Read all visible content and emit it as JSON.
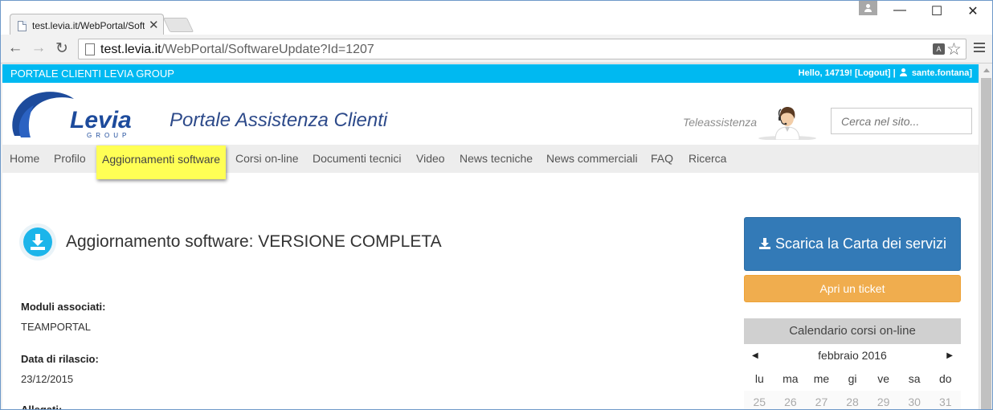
{
  "browser": {
    "tab_title": "test.levia.it/WebPortal/Soft",
    "tab_close": "✕",
    "url_host": "test.levia.it",
    "url_path": "/WebPortal/SoftwareUpdate?Id=1207",
    "translate_glyph": "A",
    "star_glyph": "☆",
    "window_minimize": "—",
    "window_maximize": "☐",
    "window_close": "✕",
    "back_glyph": "←",
    "forward_glyph": "→",
    "reload_glyph": "↻"
  },
  "topbar": {
    "title": "PORTALE CLIENTI LEVIA GROUP",
    "greeting": "Hello, 14719! [Logout] |",
    "username": "sante.fontana]"
  },
  "header": {
    "logo_text": "Levia",
    "logo_sub": "GROUP",
    "portal_title": "Portale Assistenza Clienti",
    "teleassistenza": "Teleassistenza",
    "search_placeholder": "Cerca nel sito..."
  },
  "menu": {
    "items": [
      {
        "label": "Home"
      },
      {
        "label": "Profilo"
      },
      {
        "label": "Aggiornamenti software",
        "active": true
      },
      {
        "label": "Corsi on-line"
      },
      {
        "label": "Documenti tecnici"
      },
      {
        "label": "Video"
      },
      {
        "label": "News tecniche"
      },
      {
        "label": "News commerciali"
      },
      {
        "label": "FAQ"
      },
      {
        "label": "Ricerca"
      }
    ]
  },
  "main": {
    "heading": "Aggiornamento software: VERSIONE COMPLETA",
    "fields": [
      {
        "label": "Moduli associati:",
        "value": "TEAMPORTAL"
      },
      {
        "label": "Data di rilascio:",
        "value": "23/12/2015"
      },
      {
        "label": "Allegati:",
        "value": ""
      }
    ]
  },
  "sidebar": {
    "charter_button": "Scarica la Carta dei servizi",
    "ticket_button": "Apri un ticket",
    "calendar": {
      "title": "Calendario corsi on-line",
      "month": "febbraio 2016",
      "prev": "◀",
      "next": "▶",
      "weekdays": [
        "lu",
        "ma",
        "me",
        "gi",
        "ve",
        "sa",
        "do"
      ],
      "first_row": [
        "25",
        "26",
        "27",
        "28",
        "29",
        "30",
        "31"
      ]
    }
  },
  "colors": {
    "topbar": "#00b9f1",
    "brand_blue": "#2d4a8a",
    "primary_button": "#337ab7",
    "warning_button": "#f0ad4e",
    "menu_highlight": "#ffff55"
  }
}
